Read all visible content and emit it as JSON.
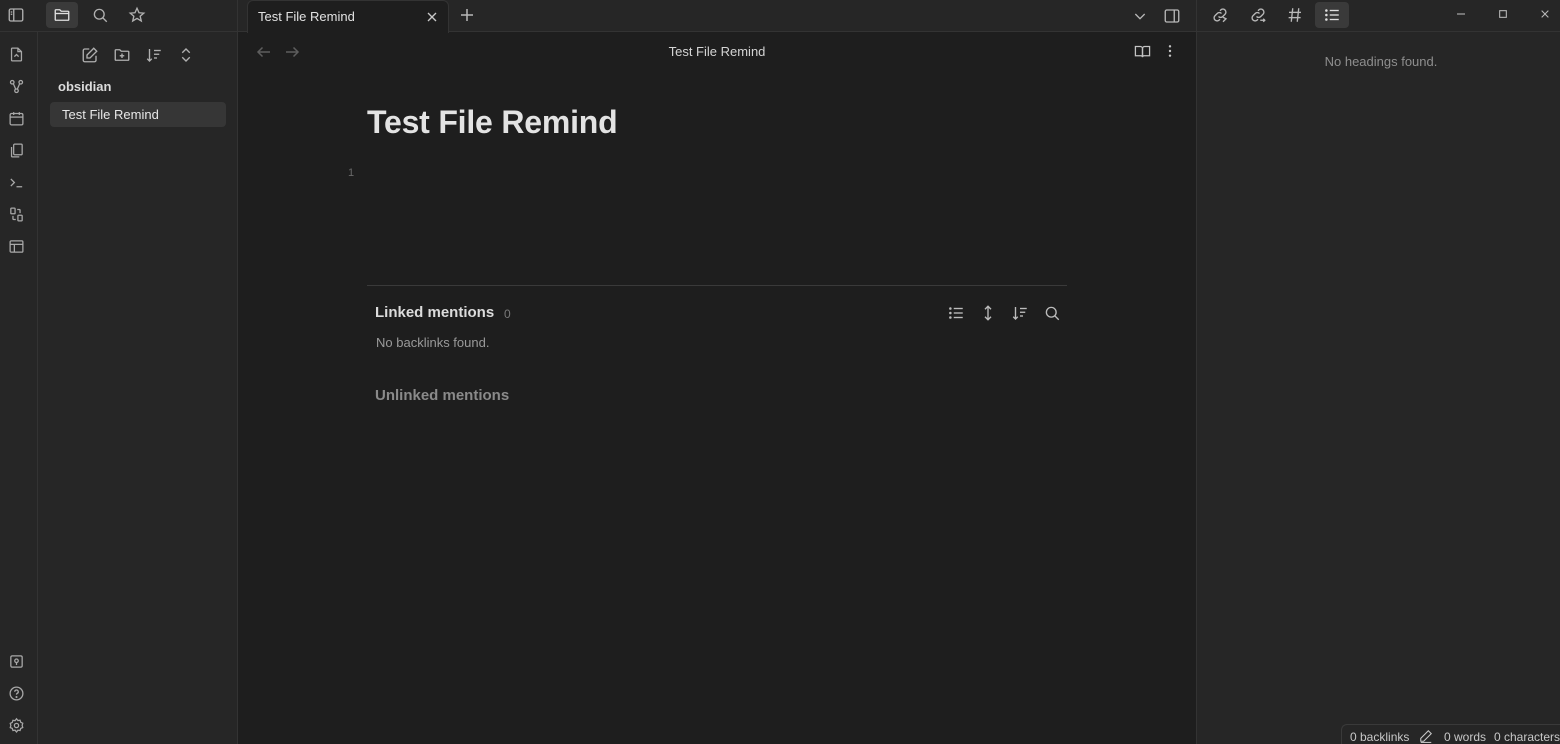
{
  "window": {
    "tab_title": "Test File Remind",
    "view_title": "Test File Remind"
  },
  "ribbon": {
    "top_icons": [
      "open-quick-switcher-icon",
      "graph-view-icon",
      "daily-note-calendar-icon",
      "templates-icon",
      "command-palette-icon",
      "canvas-icon",
      "slides-layout-icon"
    ],
    "bottom_icons": [
      "vault-switch-icon",
      "help-icon",
      "settings-icon"
    ]
  },
  "left_sidebar": {
    "tabs": [
      "files-icon",
      "search-icon",
      "bookmarks-icon"
    ],
    "active_tab": "files-icon",
    "toolbar": [
      "new-note-icon",
      "new-folder-icon",
      "sort-icon",
      "collapse-all-icon"
    ],
    "vault_name": "obsidian",
    "files": [
      {
        "label": "Test File Remind",
        "active": true
      }
    ]
  },
  "editor": {
    "inline_title": "Test File Remind",
    "line_number": "1"
  },
  "backlinks": {
    "linked_title": "Linked mentions",
    "linked_count": "0",
    "empty_text": "No backlinks found.",
    "unlinked_title": "Unlinked mentions"
  },
  "right_sidebar": {
    "tabs": [
      "backlinks-icon",
      "outgoing-links-icon",
      "tags-icon",
      "outline-icon"
    ],
    "active_tab": "outline-icon",
    "empty_text": "No headings found."
  },
  "status_bar": {
    "backlinks": "0 backlinks",
    "words": "0 words",
    "characters": "0 characters"
  }
}
